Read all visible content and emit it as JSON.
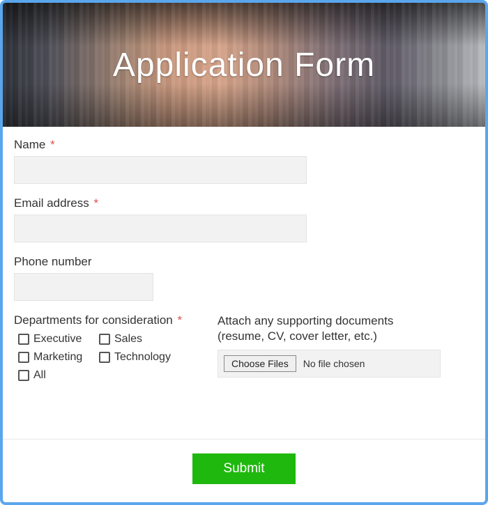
{
  "header": {
    "title": "Application Form"
  },
  "fields": {
    "name": {
      "label": "Name",
      "required": "*",
      "value": ""
    },
    "email": {
      "label": "Email address",
      "required": "*",
      "value": ""
    },
    "phone": {
      "label": "Phone number",
      "required": "",
      "value": ""
    }
  },
  "departments": {
    "label": "Departments for consideration",
    "required": "*",
    "options": {
      "executive": "Executive",
      "sales": "Sales",
      "marketing": "Marketing",
      "technology": "Technology",
      "all": "All"
    }
  },
  "attachments": {
    "label": "Attach any supporting documents (resume, CV, cover letter, etc.)",
    "button": "Choose Files",
    "status": "No file chosen"
  },
  "actions": {
    "submit": "Submit"
  }
}
